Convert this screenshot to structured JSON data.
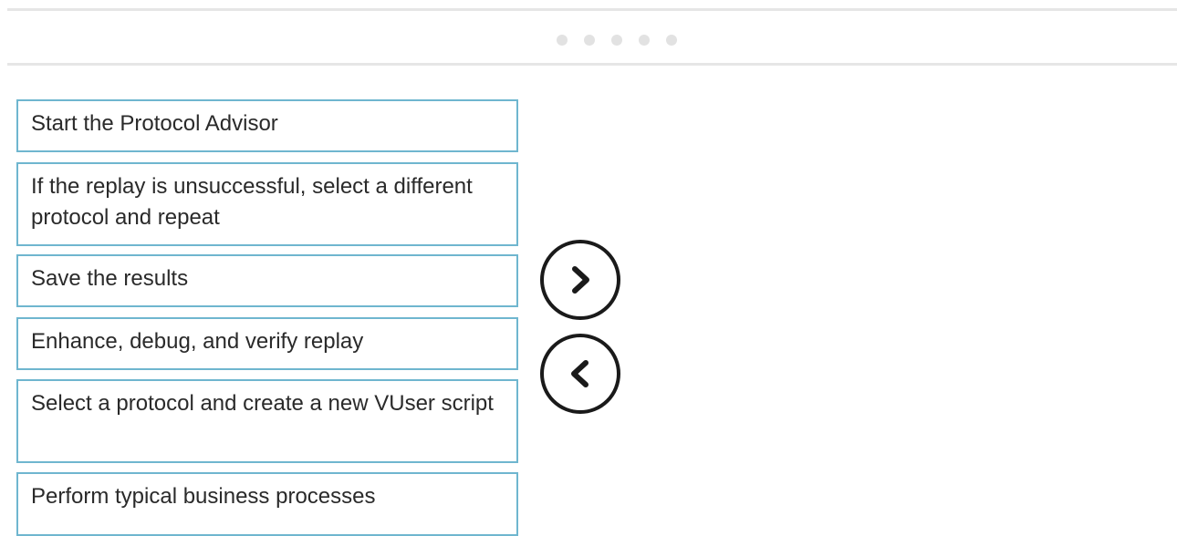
{
  "pager": {
    "dot_count": 5
  },
  "items": [
    {
      "label": "Start the Protocol Advisor"
    },
    {
      "label": "If the replay is unsuccessful, select a different protocol and repeat"
    },
    {
      "label": "Save the results"
    },
    {
      "label": "Enhance, debug, and verify replay"
    },
    {
      "label": "Select a protocol and create a new VUser script"
    },
    {
      "label": "Perform typical business processes"
    }
  ],
  "controls": {
    "move_right_icon": "chevron-right-icon",
    "move_left_icon": "chevron-left-icon"
  },
  "colors": {
    "item_border": "#6fb6cf",
    "rule": "#e6e6e6",
    "dot": "#e2e2e2",
    "arrow": "#1a1a1a"
  }
}
